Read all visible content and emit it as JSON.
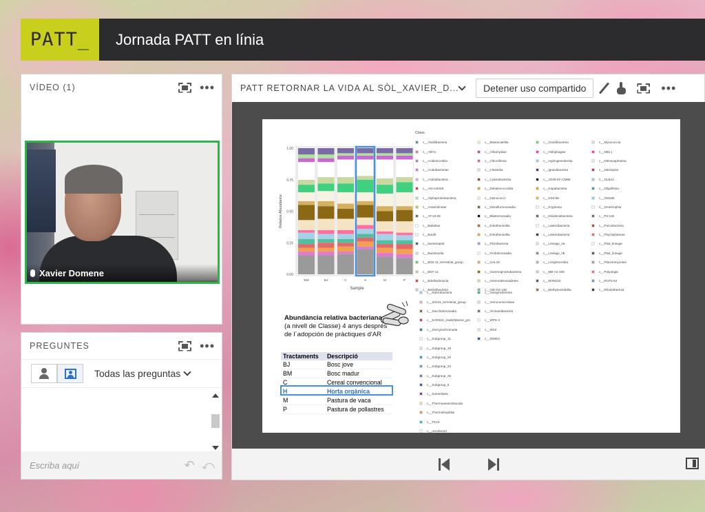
{
  "header": {
    "logo": "PATT_",
    "title": "Jornada PATT en línia"
  },
  "video_panel": {
    "title": "VÍDEO (1)",
    "participant": "Xavier Domene"
  },
  "questions_panel": {
    "title": "PREGUNTES",
    "filter": "Todas las preguntas",
    "input_placeholder": "Escriba aquí"
  },
  "share_panel": {
    "title": "PATT RETORNAR LA VIDA AL SÒL_XAVIER_D...",
    "stop_button": "Detener uso compartido"
  },
  "slide": {
    "caption_bold": "Abundància relativa bacteriana",
    "caption_rest": "(a nivell de Classe) 4 anys després de l´adopción de pràctiques d'AR",
    "table_headers": [
      "Tractaments",
      "Descripció"
    ],
    "table_rows": [
      [
        "BJ",
        "Bosc jove"
      ],
      [
        "BM",
        "Bosc madur"
      ],
      [
        "C",
        "Cereal convencional"
      ],
      [
        "H",
        "Horta orgànica"
      ],
      [
        "M",
        "Pastura de vaca"
      ],
      [
        "P",
        "Pastura de pollastres"
      ]
    ],
    "highlight_row": 3,
    "legend_title": "Class",
    "legend_columns": [
      [
        {
          "label": "c__Abditibacteria",
          "color": "#5a8fa3"
        },
        {
          "label": "c__ABY1",
          "color": "#e27b91"
        },
        {
          "label": "c__Acidimicrobiia",
          "color": "#9a8fc0"
        },
        {
          "label": "c__Acidobacteriae",
          "color": "#cf7ad4"
        },
        {
          "label": "c__Actinobacteria",
          "color": "#d2a6d6"
        },
        {
          "label": "c__AKAU4049",
          "color": "#e6393f"
        },
        {
          "label": "c__Alphaproteobacteria",
          "color": "#a8d8e0"
        },
        {
          "label": "c__Anaerolineae",
          "color": "#9ed35b"
        },
        {
          "label": "c__AT-s3-28",
          "color": "#6e6e6e"
        },
        {
          "label": "c__Babeliae",
          "color": "#ffffff"
        },
        {
          "label": "c__Bacilli",
          "color": "#f2f2f2"
        },
        {
          "label": "c__bacteriap25",
          "color": "#3c6e79"
        },
        {
          "label": "c__Bacteroidia",
          "color": "#e0d6c0"
        },
        {
          "label": "c__BD2-11_terrestrial_group",
          "color": "#7fbf7f"
        },
        {
          "label": "c__BD7-11",
          "color": "#d0c0a0"
        },
        {
          "label": "c__Bdellovibrionia",
          "color": "#e84040"
        },
        {
          "label": "c__Berkelbacteria",
          "color": "#b7c7e0"
        }
      ],
      [
        {
          "label": "c__Blastocatellia",
          "color": "#f5e6c8"
        },
        {
          "label": "c__Chlamydiae",
          "color": "#c44a8a"
        },
        {
          "label": "c__Chloroflexia",
          "color": "#e0609a"
        },
        {
          "label": "c__Clostridia",
          "color": "#f0d0e0"
        },
        {
          "label": "c__Cyanobacteriia",
          "color": "#a33a3a"
        },
        {
          "label": "c__Dehalococcoidia",
          "color": "#c8a040"
        },
        {
          "label": "c__Deinococci",
          "color": "#f4efe0"
        },
        {
          "label": "c__Desulfuromonadia",
          "color": "#7a6a40"
        },
        {
          "label": "c__Blastomonadia",
          "color": "#111111"
        },
        {
          "label": "c__Entotheonellia",
          "color": "#b06a3a"
        },
        {
          "label": "c__Entotheonellia",
          "color": "#f0a050"
        },
        {
          "label": "c__Fibrobacteria",
          "color": "#90a0c0"
        },
        {
          "label": "c__Fimbriimonadia",
          "color": "#f3f3f3"
        },
        {
          "label": "c__GAL15",
          "color": "#d4b060"
        },
        {
          "label": "c__Gammaproteobacteria",
          "color": "#8b6914"
        },
        {
          "label": "c__Gemmatimonadetes",
          "color": "#e0cfa0"
        },
        {
          "label": "c__Gitt-GS-136",
          "color": "#a0a0a0"
        }
      ],
      [
        {
          "label": "c__Gracilibacteria",
          "color": "#78c878"
        },
        {
          "label": "c__Holophagae",
          "color": "#ff33cc"
        },
        {
          "label": "c__Hydrogenedentia",
          "color": "#9ec9f0"
        },
        {
          "label": "c__Ignavibacteria",
          "color": "#5a2d82"
        },
        {
          "label": "c__JG30-KF-CM66",
          "color": "#1a1a1a"
        },
        {
          "label": "c__Kapabacteria",
          "color": "#d4a040"
        },
        {
          "label": "c__KD4-96",
          "color": "#e6c020"
        },
        {
          "label": "c__Kryptonia",
          "color": "#f0f0f0"
        },
        {
          "label": "c__Kleidoniobacteria",
          "color": "#666666"
        },
        {
          "label": "c__Latescibacteria",
          "color": "#f5f5f5"
        },
        {
          "label": "c__Latescibacteria",
          "color": "#3a3a3a"
        },
        {
          "label": "c__Lineage_IIa",
          "color": "#dddddd"
        },
        {
          "label": "c__Lineage_IIb",
          "color": "#8a8a8a"
        },
        {
          "label": "c__Longimicrobia",
          "color": "#b0b0b0"
        },
        {
          "label": "c__MB-A2-108",
          "color": "#c8c8c8"
        },
        {
          "label": "c__MVM115",
          "color": "#5a5a5a"
        },
        {
          "label": "c__Methylomirabilia",
          "color": "#9a7040"
        }
      ],
      [
        {
          "label": "c__Myxococcia",
          "color": "#f0c8e0"
        },
        {
          "label": "c__NB1-j",
          "color": "#ff3aa0"
        },
        {
          "label": "c__Nitrososphaeria",
          "color": "#e0f0d0"
        },
        {
          "label": "c__Nitrospiria",
          "color": "#c03060"
        },
        {
          "label": "c__OLB14",
          "color": "#a0c8d8"
        },
        {
          "label": "c__Oligoflexia",
          "color": "#3ca0a0"
        },
        {
          "label": "c__OM190",
          "color": "#80d8e0"
        },
        {
          "label": "c__Omnitrophia",
          "color": "#f5f5f5"
        },
        {
          "label": "c__P2-11E",
          "color": "#707070"
        },
        {
          "label": "c__Parcubacteria",
          "color": "#c83a3a"
        },
        {
          "label": "c__Phycisphaerae",
          "color": "#ff6060"
        },
        {
          "label": "c__Pla3_lineage",
          "color": "#f3f3f3"
        },
        {
          "label": "c__Pla4_lineage",
          "color": "#555555"
        },
        {
          "label": "c__Planctomycetes",
          "color": "#a0a0a0"
        },
        {
          "label": "c__Polyangia",
          "color": "#e06aa8"
        },
        {
          "label": "c__RCP2-54",
          "color": "#6a9ac0"
        },
        {
          "label": "c__Rhodothermia",
          "color": "#3a3a3a"
        }
      ],
      [
        {
          "label": "c__Rubrobacteria",
          "color": "#a0c8e8"
        },
        {
          "label": "c__S0134_terrestrial_group",
          "color": "#f0a8b8"
        },
        {
          "label": "c__Saccharimonadia",
          "color": "#9a6040"
        },
        {
          "label": "c__SAR324_clade(Marine_gro",
          "color": "#b05050"
        },
        {
          "label": "c__Sericytochromatia",
          "color": "#2a8a7a"
        },
        {
          "label": "c__Subgroup_11",
          "color": "#f0f0f0"
        },
        {
          "label": "c__Subgroup_18",
          "color": "#dddddd"
        },
        {
          "label": "c__Subgroup_20",
          "color": "#40a0c8"
        },
        {
          "label": "c__Subgroup_22",
          "color": "#5aa0d0"
        },
        {
          "label": "c__Subgroup_25",
          "color": "#6a80c0"
        },
        {
          "label": "c__Subgroup_5",
          "color": "#3a60a8"
        },
        {
          "label": "c__Sumerlaeia",
          "color": "#8a3ab0"
        },
        {
          "label": "c__Thermoanaerobaculia",
          "color": "#f0d8a0"
        },
        {
          "label": "c__Thermoleophilia",
          "color": "#e89040"
        },
        {
          "label": "c__TK10",
          "color": "#20c8c0"
        },
        {
          "label": "c__uncultured",
          "color": "#f0f0f0"
        },
        {
          "label": "c__vadinHA49",
          "color": "#f0a0c0"
        }
      ],
      [
        {
          "label": "c__Vampirivibrionia",
          "color": "#20c080"
        },
        {
          "label": "c__Verrucomicrobiae",
          "color": "#d8d8d8"
        },
        {
          "label": "c__Vicinamibacteria",
          "color": "#707070"
        },
        {
          "label": "c__WPS-2",
          "color": "#f3f3f3"
        },
        {
          "label": "c__WS2",
          "color": "#e0e0e0"
        },
        {
          "label": "c__WWE3",
          "color": "#3050c0"
        }
      ]
    ]
  },
  "chart_data": {
    "type": "bar",
    "stacked": true,
    "ylabel": "Relative Abundance",
    "xlabel": "Sample",
    "y_ticks": [
      "0.00",
      "0.25",
      "0.50",
      "0.75",
      "1.00"
    ],
    "ylim": [
      0,
      1
    ],
    "categories": [
      "BM",
      "BJ",
      "C",
      "H",
      "M",
      "P"
    ],
    "highlight_category": "H",
    "series": [
      {
        "color": "#9a9a9a",
        "values": [
          0.15,
          0.15,
          0.16,
          0.2,
          0.14,
          0.13
        ]
      },
      {
        "color": "#e07ad0",
        "values": [
          0.03,
          0.03,
          0.02,
          0.02,
          0.03,
          0.03
        ]
      },
      {
        "color": "#f3a050",
        "values": [
          0.03,
          0.03,
          0.04,
          0.04,
          0.04,
          0.04
        ]
      },
      {
        "color": "#e06a6a",
        "values": [
          0.03,
          0.04,
          0.03,
          0.03,
          0.03,
          0.04
        ]
      },
      {
        "color": "#50c0a0",
        "values": [
          0.04,
          0.03,
          0.03,
          0.03,
          0.03,
          0.03
        ]
      },
      {
        "color": "#a8d0e8",
        "values": [
          0.05,
          0.04,
          0.04,
          0.04,
          0.05,
          0.04
        ]
      },
      {
        "color": "#ff6fa0",
        "values": [
          0.02,
          0.03,
          0.03,
          0.03,
          0.02,
          0.02
        ]
      },
      {
        "color": "#f4e4c4",
        "values": [
          0.08,
          0.09,
          0.09,
          0.06,
          0.08,
          0.09
        ]
      },
      {
        "color": "#8b6914",
        "values": [
          0.12,
          0.1,
          0.08,
          0.1,
          0.08,
          0.09
        ]
      },
      {
        "color": "#d4b060",
        "values": [
          0.03,
          0.04,
          0.04,
          0.03,
          0.04,
          0.03
        ]
      },
      {
        "color": "#f7f2e2",
        "values": [
          0.07,
          0.08,
          0.09,
          0.07,
          0.1,
          0.11
        ]
      },
      {
        "color": "#40d080",
        "values": [
          0.06,
          0.06,
          0.07,
          0.1,
          0.07,
          0.08
        ]
      },
      {
        "color": "#c8d8a0",
        "values": [
          0.04,
          0.05,
          0.05,
          0.03,
          0.05,
          0.04
        ]
      },
      {
        "color": "#ffffff",
        "values": [
          0.14,
          0.12,
          0.14,
          0.13,
          0.15,
          0.14
        ]
      },
      {
        "color": "#c868d0",
        "values": [
          0.03,
          0.03,
          0.03,
          0.03,
          0.03,
          0.03
        ]
      },
      {
        "color": "#b0e0a0",
        "values": [
          0.03,
          0.03,
          0.02,
          0.02,
          0.02,
          0.02
        ]
      },
      {
        "color": "#7a6aa8",
        "values": [
          0.05,
          0.05,
          0.04,
          0.04,
          0.04,
          0.04
        ]
      }
    ]
  }
}
